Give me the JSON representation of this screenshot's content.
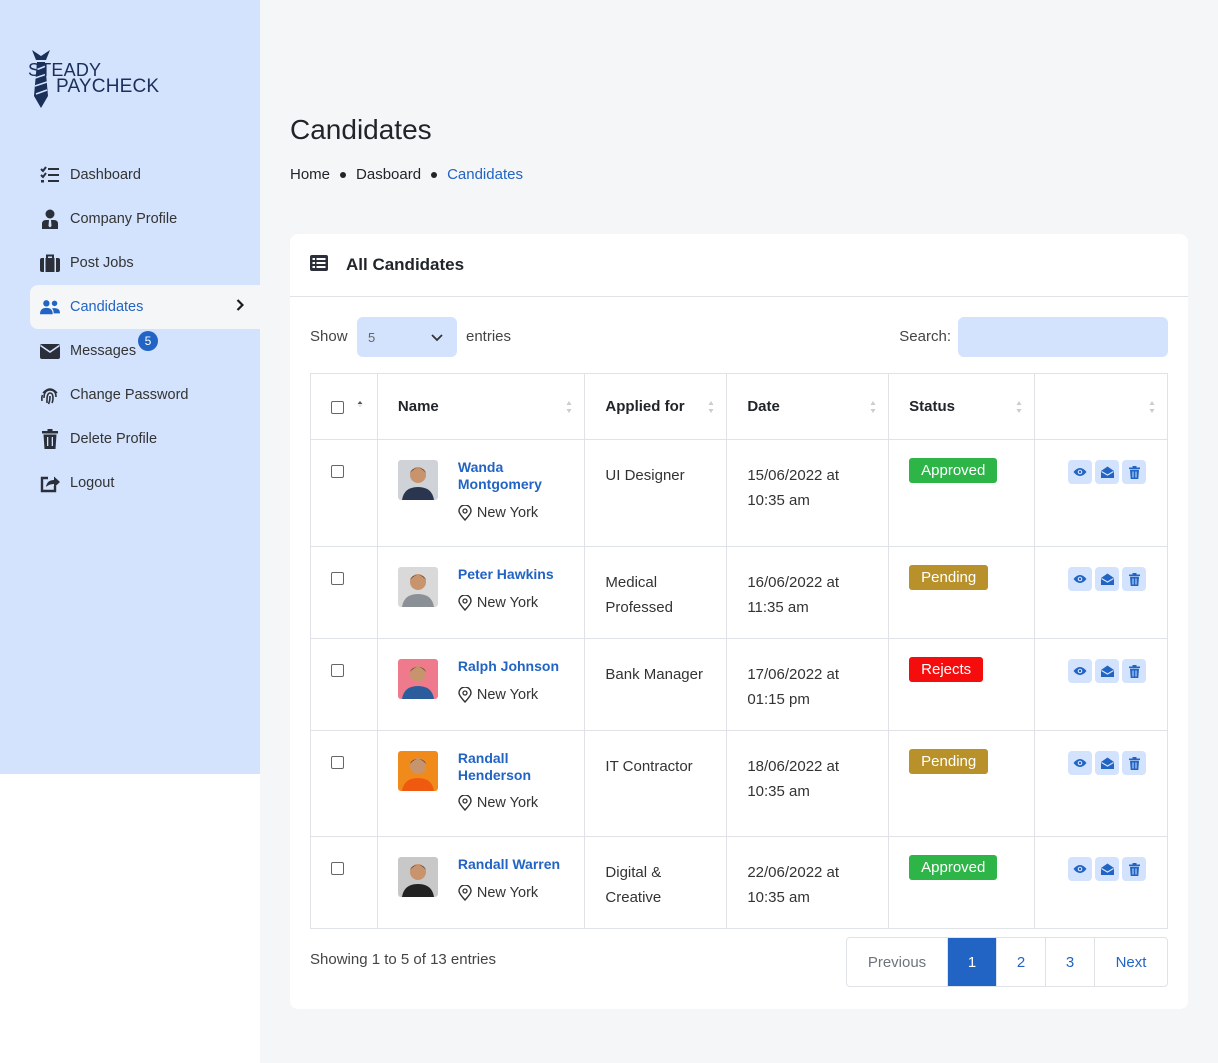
{
  "brand": {
    "line1": "STEADY",
    "line2": "PAYCHECK"
  },
  "sidebar": {
    "items": [
      {
        "label": "Dashboard",
        "icon": "list-check-icon"
      },
      {
        "label": "Company Profile",
        "icon": "user-icon"
      },
      {
        "label": "Post Jobs",
        "icon": "briefcase-icon"
      },
      {
        "label": "Candidates",
        "icon": "users-icon",
        "active": true
      },
      {
        "label": "Messages",
        "icon": "envelope-icon",
        "badge": "5"
      },
      {
        "label": "Change Password",
        "icon": "fingerprint-icon"
      },
      {
        "label": "Delete Profile",
        "icon": "trash-icon"
      },
      {
        "label": "Logout",
        "icon": "logout-icon"
      }
    ]
  },
  "header": {
    "title": "Candidates",
    "breadcrumb": [
      "Home",
      "Dasboard",
      "Candidates"
    ]
  },
  "card": {
    "title": "All Candidates"
  },
  "controls": {
    "show_label": "Show",
    "entries_value": "5",
    "entries_label": "entries",
    "search_label": "Search:"
  },
  "table": {
    "columns": [
      "Name",
      "Applied for",
      "Date",
      "Status"
    ],
    "rows": [
      {
        "name": "Wanda Montgomery",
        "location": "New York",
        "applied": "UI Designer",
        "date": "15/06/2022 at 10:35 am",
        "status": "Approved"
      },
      {
        "name": "Peter Hawkins",
        "location": "New York",
        "applied": "Medical Professed",
        "date": "16/06/2022 at 11:35 am",
        "status": "Pending"
      },
      {
        "name": "Ralph Johnson",
        "location": "New York",
        "applied": "Bank Manager",
        "date": "17/06/2022 at 01:15 pm",
        "status": "Rejects"
      },
      {
        "name": "Randall Henderson",
        "location": "New York",
        "applied": "IT Contractor",
        "date": "18/06/2022 at 10:35 am",
        "status": "Pending"
      },
      {
        "name": "Randall Warren",
        "location": "New York",
        "applied": "Digital & Creative",
        "date": "22/06/2022 at 10:35 am",
        "status": "Approved"
      }
    ]
  },
  "status_colors": {
    "Approved": "#2eb548",
    "Pending": "#b8912a",
    "Rejects": "#f50d0d"
  },
  "footer": {
    "showing": "Showing 1 to 5 of 13 entries",
    "prev": "Previous",
    "pages": [
      "1",
      "2",
      "3"
    ],
    "next": "Next",
    "active_page": "1"
  },
  "colors": {
    "accent": "#2264c3",
    "sidebar_bg": "#d3e3fd"
  }
}
